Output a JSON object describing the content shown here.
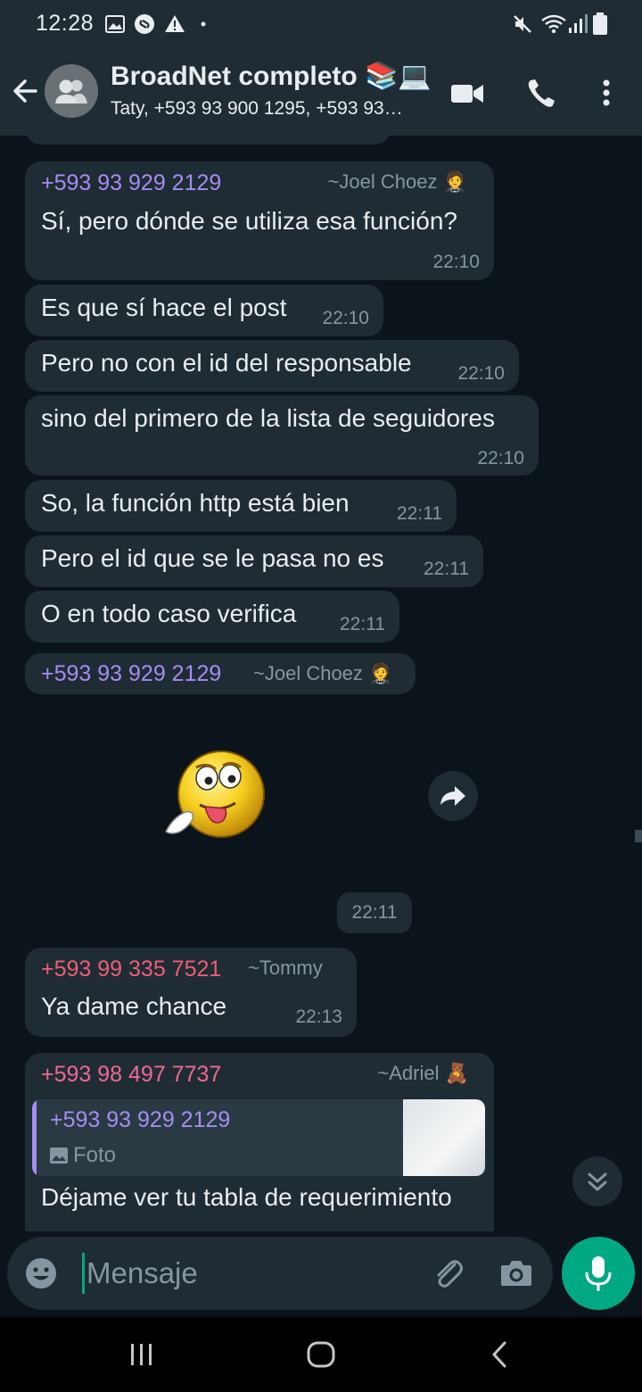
{
  "status_bar": {
    "time": "12:28"
  },
  "header": {
    "title": "BroadNet completo 📚💻",
    "subtitle": "Taty, +593 93 900 1295, +593 93…"
  },
  "messages": [
    {
      "sender": "+593 93 929 2129",
      "alias": "~Joel Choez 🤵",
      "text": "Sí, pero dónde se utiliza esa función?",
      "time": "22:10"
    },
    {
      "text": "Es que sí hace el post",
      "time": "22:10"
    },
    {
      "text": "Pero no con el id del responsable",
      "time": "22:10"
    },
    {
      "text": "sino del primero de la lista de seguidores",
      "time": "22:10"
    },
    {
      "text": "So, la función http está bien",
      "time": "22:11"
    },
    {
      "text": "Pero el id que se le pasa no es",
      "time": "22:11"
    },
    {
      "text": "O en todo caso verifica",
      "time": "22:11"
    },
    {
      "sender": "+593 93 929 2129",
      "alias": "~Joel Choez 🤵"
    },
    {
      "time": "22:11"
    },
    {
      "sender": "+593 99 335 7521",
      "alias": "~Tommy",
      "text": "Ya dame chance",
      "time": "22:13"
    },
    {
      "sender": "+593 98 497 7737",
      "alias": "~Adriel 🧸",
      "quote_sender": "+593 93 929 2129",
      "quote_text": "Foto",
      "text": "Déjame ver tu tabla de requerimiento"
    }
  ],
  "input": {
    "placeholder": "Mensaje"
  },
  "colors": {
    "background": "#0b141a",
    "bubble": "#1f2c34",
    "accent": "#00a884",
    "sender_purple": "#a58cf4",
    "sender_red": "#f25c76",
    "sender_pink": "#f0698e"
  },
  "icons": {
    "status": [
      "gallery-icon",
      "shazam-icon",
      "warning-icon",
      "dot-icon",
      "mute-icon",
      "wifi-icon",
      "signal-icon",
      "battery-icon"
    ],
    "header": [
      "back-arrow-icon",
      "group-avatar-icon",
      "video-call-icon",
      "phone-icon",
      "more-vert-icon"
    ],
    "input": [
      "emoji-icon",
      "attach-icon",
      "camera-icon",
      "mic-icon"
    ],
    "nav": [
      "recents-icon",
      "home-icon",
      "back-icon"
    ]
  }
}
